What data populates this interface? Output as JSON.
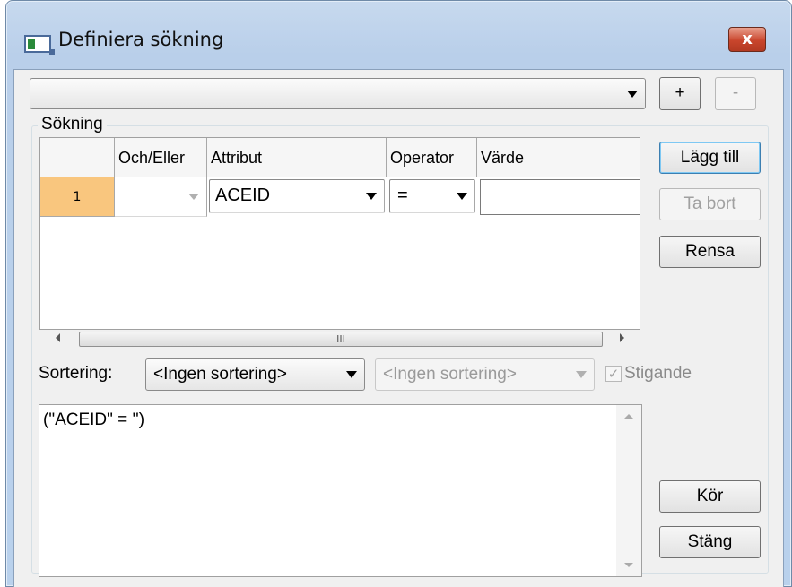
{
  "window": {
    "title": "Definiera sökning",
    "close_glyph": "x"
  },
  "toolbar": {
    "query_select": "",
    "add_label": "+",
    "remove_label": "-"
  },
  "group": {
    "label": "Sökning"
  },
  "grid": {
    "columns": [
      "Och/Eller",
      "Attribut",
      "Operator",
      "Värde"
    ],
    "rows": [
      {
        "number": "1",
        "and_or": "",
        "attribute": "ACEID",
        "operator": "=",
        "value": ""
      }
    ]
  },
  "side_buttons": {
    "add": "Lägg till",
    "remove": "Ta bort",
    "clear": "Rensa"
  },
  "sort": {
    "label": "Sortering:",
    "primary": "<Ingen sortering>",
    "secondary": "<Ingen sortering>",
    "ascending_label": "Stigande",
    "ascending_checked": true
  },
  "query_text": "(\"ACEID\" = '')",
  "bottom_buttons": {
    "run": "Kör",
    "close": "Stäng"
  },
  "scrollbar": {
    "grip": "III"
  }
}
